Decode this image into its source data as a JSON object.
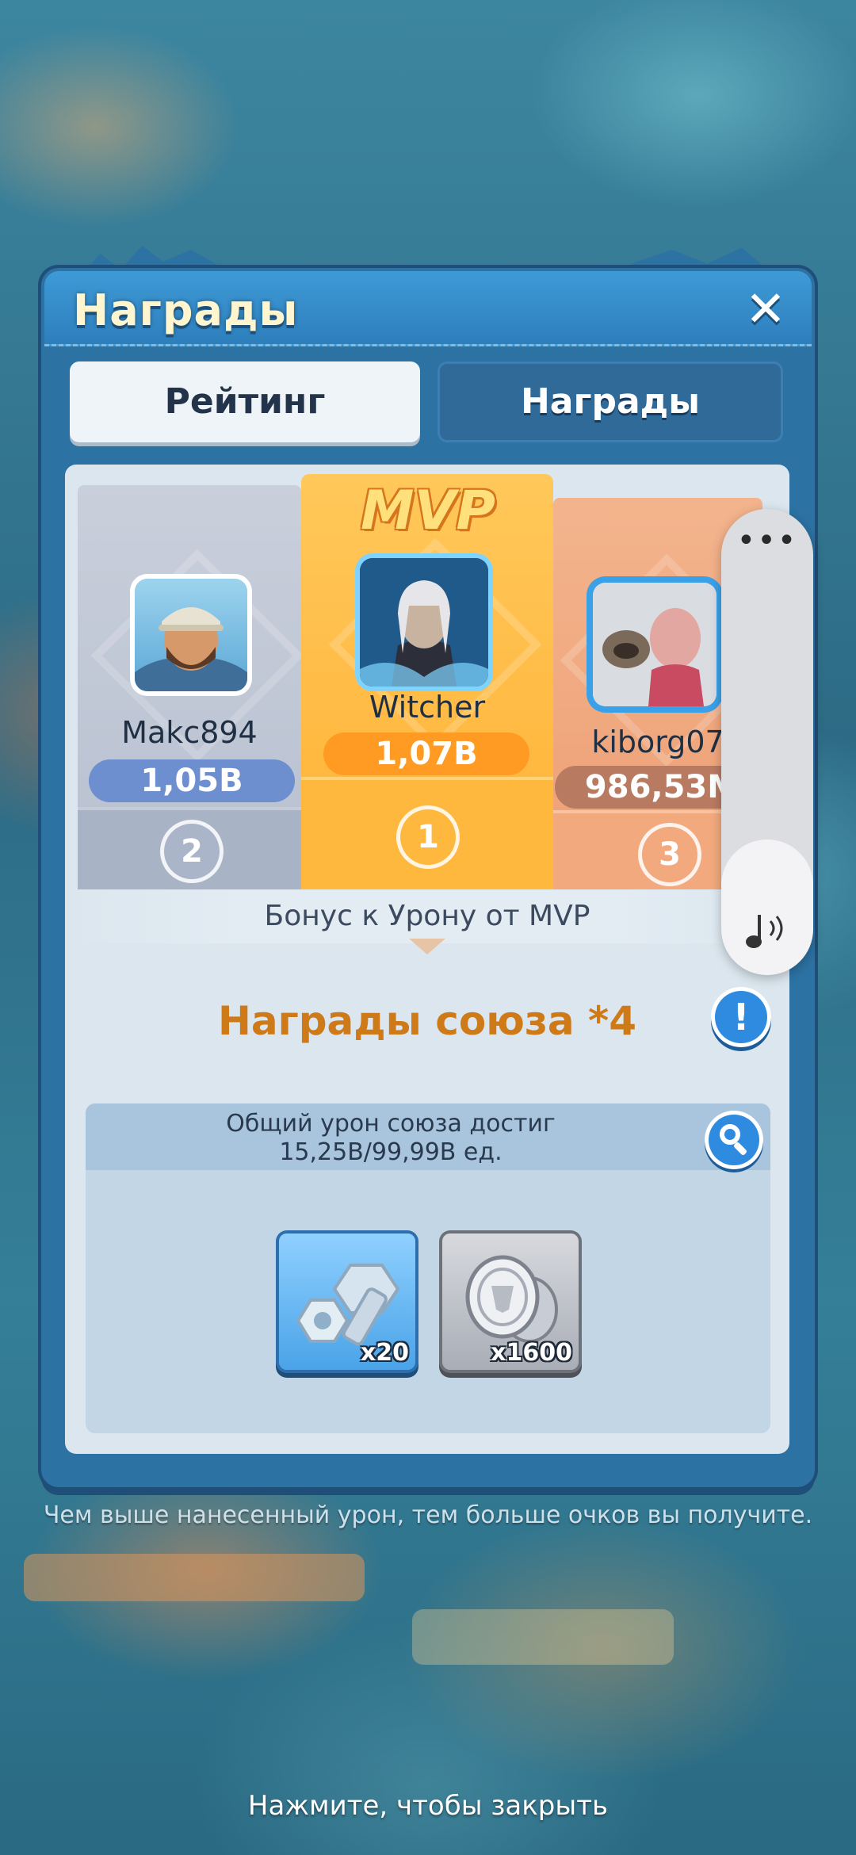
{
  "dialog": {
    "title": "Награды",
    "close_icon": "close-icon"
  },
  "tabs": [
    {
      "label": "Рейтинг",
      "active": true
    },
    {
      "label": "Награды",
      "active": false
    }
  ],
  "podium": {
    "mvp_badge": "MVP",
    "players": [
      {
        "rank": "2",
        "name": "Makc894",
        "score": "1,05B"
      },
      {
        "rank": "1",
        "name": "Witcher",
        "score": "1,07B"
      },
      {
        "rank": "3",
        "name": "kiborg07",
        "score": "986,53M"
      }
    ]
  },
  "bonus_text": "Бонус к Урону от MVP",
  "alliance": {
    "title": "Награды союза *4",
    "info_icon": "info-icon",
    "damage_line1": "Общий урон союза достиг",
    "damage_line2": "15,25B/99,99B ед.",
    "search_icon": "search-icon",
    "rewards": [
      {
        "icon": "bolt-nut-icon",
        "quantity": "x20"
      },
      {
        "icon": "silver-coins-icon",
        "quantity": "x1600"
      }
    ]
  },
  "hint": "Чем выше нанесенный урон, тем больше очков вы получите.",
  "tap_to_close": "Нажмите, чтобы закрыть",
  "volume_panel": {
    "more_icon": "more-dots-icon",
    "sound_icon": "music-note-icon",
    "level": 0.29
  },
  "colors": {
    "accent_gold": "#ffb236",
    "alliance_title": "#cf7a18",
    "panel_blue": "#2c72a3"
  }
}
